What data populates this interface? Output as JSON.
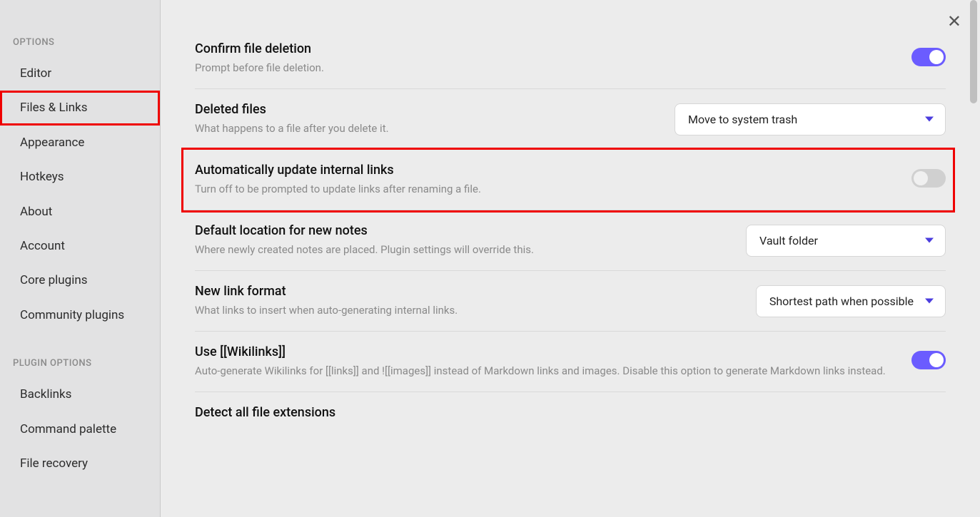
{
  "sidebar": {
    "sections": [
      {
        "title": "OPTIONS",
        "items": [
          {
            "label": "Editor",
            "active": false
          },
          {
            "label": "Files & Links",
            "active": true
          },
          {
            "label": "Appearance",
            "active": false
          },
          {
            "label": "Hotkeys",
            "active": false
          },
          {
            "label": "About",
            "active": false
          },
          {
            "label": "Account",
            "active": false
          },
          {
            "label": "Core plugins",
            "active": false
          },
          {
            "label": "Community plugins",
            "active": false
          }
        ]
      },
      {
        "title": "PLUGIN OPTIONS",
        "items": [
          {
            "label": "Backlinks",
            "active": false
          },
          {
            "label": "Command palette",
            "active": false
          },
          {
            "label": "File recovery",
            "active": false
          }
        ]
      }
    ]
  },
  "settings": {
    "confirm_delete": {
      "title": "Confirm file deletion",
      "desc": "Prompt before file deletion.",
      "toggle_on": true
    },
    "deleted_files": {
      "title": "Deleted files",
      "desc": "What happens to a file after you delete it.",
      "dropdown_value": "Move to system trash"
    },
    "auto_update_links": {
      "title": "Automatically update internal links",
      "desc": "Turn off to be prompted to update links after renaming a file.",
      "toggle_on": false
    },
    "default_location": {
      "title": "Default location for new notes",
      "desc": "Where newly created notes are placed. Plugin settings will override this.",
      "dropdown_value": "Vault folder"
    },
    "new_link_format": {
      "title": "New link format",
      "desc": "What links to insert when auto-generating internal links.",
      "dropdown_value": "Shortest path when possible"
    },
    "wikilinks": {
      "title": "Use [[Wikilinks]]",
      "desc": "Auto-generate Wikilinks for [[links]] and ![[images]] instead of Markdown links and images. Disable this option to generate Markdown links instead.",
      "toggle_on": true
    },
    "detect_ext": {
      "title": "Detect all file extensions"
    }
  },
  "close_label": "✕"
}
